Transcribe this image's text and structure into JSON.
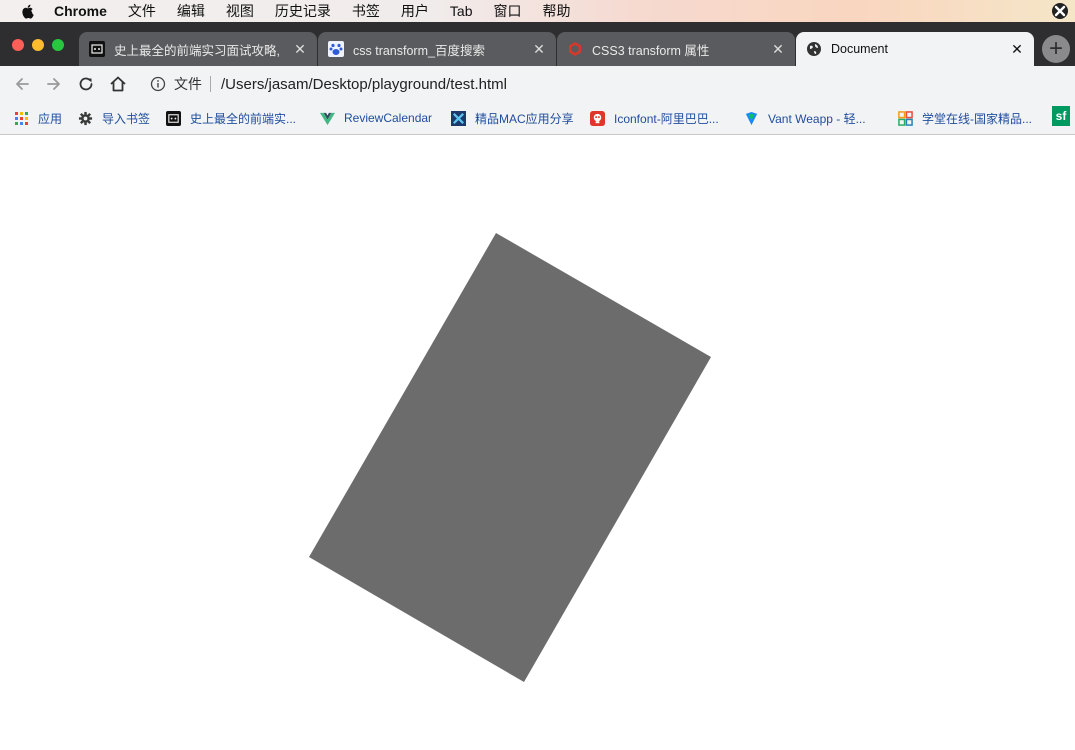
{
  "menubar": {
    "app_name": "Chrome",
    "items": [
      "文件",
      "编辑",
      "视图",
      "历史记录",
      "书签",
      "用户",
      "Tab",
      "窗口",
      "帮助"
    ]
  },
  "tabs": [
    {
      "title": "史上最全的前端实习面试攻略,",
      "icon": "dark-site-icon",
      "close": "✕"
    },
    {
      "title": "css transform_百度搜索",
      "icon": "baidu-paw-icon",
      "close": "✕"
    },
    {
      "title": "CSS3 transform 属性",
      "icon": "red-cube-icon",
      "close": "✕"
    },
    {
      "title": "Document",
      "icon": "globe-icon",
      "close": "✕",
      "active": true
    }
  ],
  "new_tab_label": "+",
  "omnibox": {
    "scheme_label": "文件",
    "url": "/Users/jasam/Desktop/playground/test.html"
  },
  "bookmarks": [
    {
      "label": "应用",
      "icon": "apps-grid-icon"
    },
    {
      "label": "导入书签",
      "icon": "gear-icon"
    },
    {
      "label": "史上最全的前端实...",
      "icon": "dark-site-icon"
    },
    {
      "label": "ReviewCalendar",
      "icon": "vue-logo-icon"
    },
    {
      "label": "精品MAC应用分享",
      "icon": "x-logo-icon"
    },
    {
      "label": "Iconfont-阿里巴巴...",
      "icon": "iconfont-icon"
    },
    {
      "label": "Vant Weapp - 轻...",
      "icon": "vant-icon"
    },
    {
      "label": "学堂在线-国家精品...",
      "icon": "xuetang-icon"
    },
    {
      "label": "sf",
      "icon": "sf-icon"
    }
  ],
  "page": {
    "box_color": "#6c6c6c",
    "box_rotation_deg": 30
  },
  "colors": {
    "tabstrip": "#2e2e30",
    "toolbar": "#f1f3f4",
    "bookmark_text": "#1f4d9e"
  }
}
